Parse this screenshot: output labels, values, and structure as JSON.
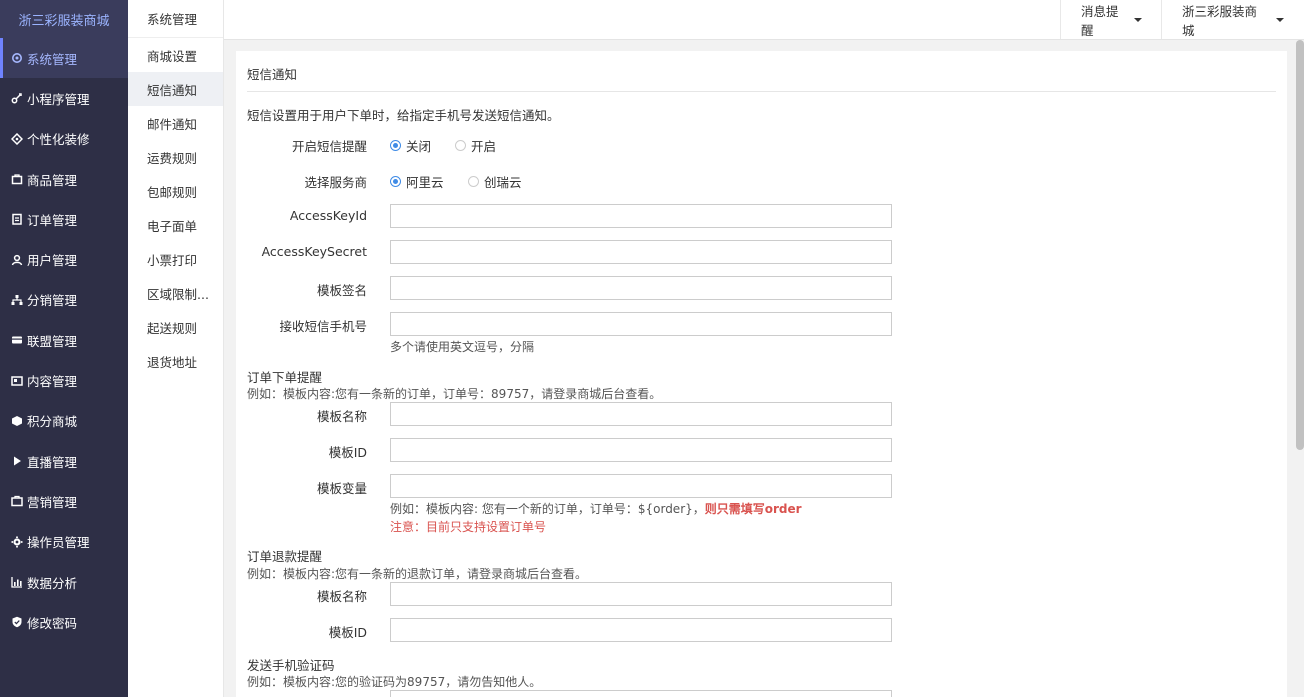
{
  "brand": "浙三彩服装商城",
  "sidebar": {
    "items": [
      {
        "label": "系统管理",
        "icon": "gear-icon",
        "active": true
      },
      {
        "label": "小程序管理",
        "icon": "link-icon"
      },
      {
        "label": "个性化装修",
        "icon": "decor-icon"
      },
      {
        "label": "商品管理",
        "icon": "bag-icon"
      },
      {
        "label": "订单管理",
        "icon": "order-icon"
      },
      {
        "label": "用户管理",
        "icon": "user-icon"
      },
      {
        "label": "分销管理",
        "icon": "sitemap-icon"
      },
      {
        "label": "联盟管理",
        "icon": "card-icon"
      },
      {
        "label": "内容管理",
        "icon": "content-icon"
      },
      {
        "label": "积分商城",
        "icon": "cube-icon"
      },
      {
        "label": "直播管理",
        "icon": "play-icon"
      },
      {
        "label": "营销管理",
        "icon": "marketing-icon"
      },
      {
        "label": "操作员管理",
        "icon": "settings-icon"
      },
      {
        "label": "数据分析",
        "icon": "chart-icon"
      },
      {
        "label": "修改密码",
        "icon": "shield-icon"
      }
    ]
  },
  "subnav": {
    "title": "系统管理",
    "items": [
      {
        "label": "商城设置"
      },
      {
        "label": "短信通知",
        "active": true
      },
      {
        "label": "邮件通知"
      },
      {
        "label": "运费规则"
      },
      {
        "label": "包邮规则"
      },
      {
        "label": "电子面单"
      },
      {
        "label": "小票打印"
      },
      {
        "label": "区域限制..."
      },
      {
        "label": "起送规则"
      },
      {
        "label": "退货地址"
      }
    ]
  },
  "topbar": {
    "notify": "消息提醒",
    "store": "浙三彩服装商城"
  },
  "panel": {
    "title": "短信通知",
    "desc": "短信设置用于用户下单时，给指定手机号发送短信通知。",
    "enable": {
      "label": "开启短信提醒",
      "off": "关闭",
      "on": "开启"
    },
    "provider": {
      "label": "选择服务商",
      "opt1": "阿里云",
      "opt2": "创瑞云"
    },
    "access_key_id": {
      "label": "AccessKeyId",
      "value": ""
    },
    "access_key_secret": {
      "label": "AccessKeySecret",
      "value": ""
    },
    "sign": {
      "label": "模板签名",
      "value": ""
    },
    "phone": {
      "label": "接收短信手机号",
      "value": "",
      "help": "多个请使用英文逗号，分隔"
    },
    "order": {
      "title": "订单下单提醒",
      "example": "例如：模板内容:您有一条新的订单，订单号：89757，请登录商城后台查看。",
      "name_label": "模板名称",
      "id_label": "模板ID",
      "var_label": "模板变量",
      "var_help": "例如：模板内容: 您有一个新的订单，订单号：${order}，",
      "var_help_strong": "则只需填写order",
      "var_note": "注意：目前只支持设置订单号"
    },
    "refund": {
      "title": "订单退款提醒",
      "example": "例如：模板内容:您有一条新的退款订单，请登录商城后台查看。",
      "name_label": "模板名称",
      "id_label": "模板ID"
    },
    "verify": {
      "title": "发送手机验证码",
      "example": "例如：模板内容:您的验证码为89757，请勿告知他人。"
    }
  }
}
